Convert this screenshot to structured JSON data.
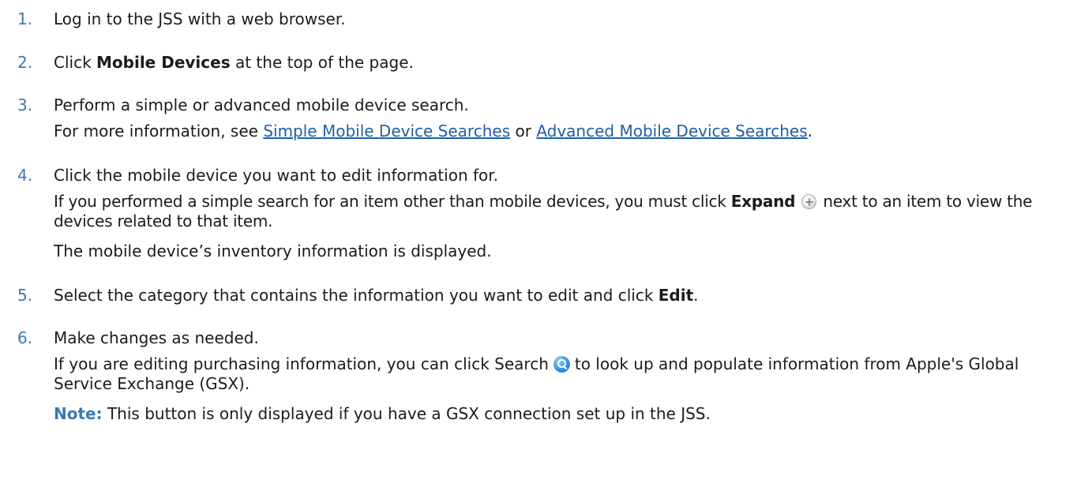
{
  "steps": [
    {
      "number": "1.",
      "text": "Log in to the JSS with a web browser."
    },
    {
      "number": "2.",
      "pre": "Click ",
      "bold": "Mobile Devices",
      "post": " at the top of the page."
    },
    {
      "number": "3.",
      "text": "Perform a simple or advanced mobile device search.",
      "info_pre": "For more information, see ",
      "link1": "Simple Mobile Device Searches",
      "info_mid": " or ",
      "link2": "Advanced Mobile Device Searches",
      "info_post": "."
    },
    {
      "number": "4.",
      "text": "Click the mobile device you want to edit information for.",
      "detail_pre": "If you performed a simple search for an item other than mobile devices, you must click ",
      "detail_bold": "Expand",
      "detail_icon": "plus-circle-icon",
      "detail_post": " next to an item to view the devices related to that item.",
      "result": "The mobile device’s inventory information is displayed."
    },
    {
      "number": "5.",
      "pre": "Select the category that contains the information you want to edit and click ",
      "bold": "Edit",
      "post": "."
    },
    {
      "number": "6.",
      "text": "Make changes as needed.",
      "detail_pre": "If you are editing purchasing information, you can click Search",
      "detail_icon": "search-icon",
      "detail_post": "to look up and populate information from Apple's Global Service Exchange (GSX).",
      "note_label": "Note:",
      "note_text": " This button is only displayed if you have a GSX connection set up in the JSS."
    }
  ],
  "colors": {
    "number": "#3a79b2",
    "link": "#1f5fa6",
    "note_label": "#3a79b2",
    "text": "#1b1b1b"
  }
}
